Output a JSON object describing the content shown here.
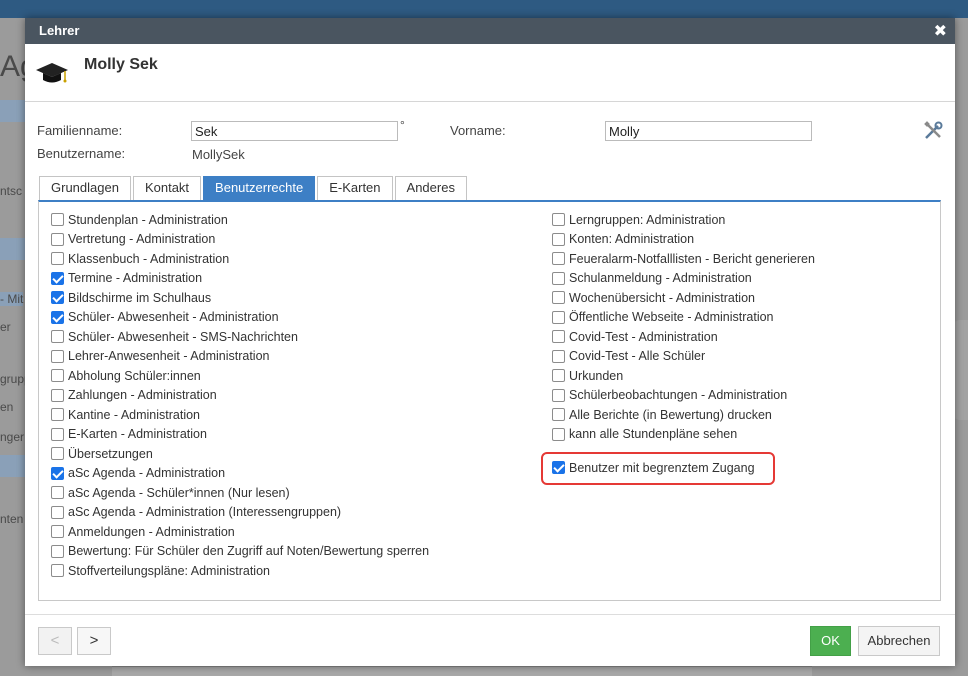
{
  "background": {
    "app_title_fragment": "Ag",
    "left_fragments": [
      "ntsc",
      "- Mit",
      "er",
      "grupp",
      "en",
      "nger",
      "nten"
    ]
  },
  "dialog": {
    "title": "Lehrer",
    "close_glyph": "✖",
    "teacher_name": "Molly Sek"
  },
  "form": {
    "familienname_label": "Familienname:",
    "familienname_value": "Sek",
    "degree_mark": "°",
    "vorname_label": "Vorname:",
    "vorname_value": "Molly",
    "benutzername_label": "Benutzername:",
    "benutzername_value": "MollySek"
  },
  "tabs": [
    {
      "label": "Grundlagen",
      "active": false
    },
    {
      "label": "Kontakt",
      "active": false
    },
    {
      "label": "Benutzerrechte",
      "active": true
    },
    {
      "label": "E-Karten",
      "active": false
    },
    {
      "label": "Anderes",
      "active": false
    }
  ],
  "permissions_left": [
    {
      "label": "Stundenplan - Administration",
      "checked": false
    },
    {
      "label": "Vertretung - Administration",
      "checked": false
    },
    {
      "label": "Klassenbuch - Administration",
      "checked": false
    },
    {
      "label": "Termine - Administration",
      "checked": true
    },
    {
      "label": "Bildschirme im Schulhaus",
      "checked": true
    },
    {
      "label": "Schüler- Abwesenheit - Administration",
      "checked": true
    },
    {
      "label": "Schüler- Abwesenheit - SMS-Nachrichten",
      "checked": false
    },
    {
      "label": "Lehrer-Anwesenheit - Administration",
      "checked": false
    },
    {
      "label": "Abholung Schüler:innen",
      "checked": false
    },
    {
      "label": "Zahlungen - Administration",
      "checked": false
    },
    {
      "label": "Kantine - Administration",
      "checked": false
    },
    {
      "label": "E-Karten - Administration",
      "checked": false
    },
    {
      "label": "Übersetzungen",
      "checked": false
    },
    {
      "label": "aSc Agenda - Administration",
      "checked": true
    },
    {
      "label": "aSc Agenda - Schüler*innen (Nur lesen)",
      "checked": false
    },
    {
      "label": "aSc Agenda - Administration (Interessengruppen)",
      "checked": false
    },
    {
      "label": "Anmeldungen - Administration",
      "checked": false
    },
    {
      "label": "Bewertung: Für Schüler den Zugriff auf Noten/Bewertung sperren",
      "checked": false
    },
    {
      "label": "Stoffverteilungspläne: Administration",
      "checked": false
    }
  ],
  "permissions_right": [
    {
      "label": "Lerngruppen: Administration",
      "checked": false
    },
    {
      "label": "Konten: Administration",
      "checked": false
    },
    {
      "label": "Feueralarm-Notfalllisten - Bericht generieren",
      "checked": false
    },
    {
      "label": "Schulanmeldung - Administration",
      "checked": false
    },
    {
      "label": "Wochenübersicht - Administration",
      "checked": false
    },
    {
      "label": "Öffentliche Webseite - Administration",
      "checked": false
    },
    {
      "label": "Covid-Test - Administration",
      "checked": false
    },
    {
      "label": "Covid-Test - Alle Schüler",
      "checked": false
    },
    {
      "label": "Urkunden",
      "checked": false
    },
    {
      "label": "Schülerbeobachtungen - Administration",
      "checked": false
    },
    {
      "label": "Alle Berichte (in Bewertung) drucken",
      "checked": false
    },
    {
      "label": "kann alle Stundenpläne sehen",
      "checked": false
    }
  ],
  "limited_access": {
    "label": "Benutzer mit begrenztem Zugang",
    "checked": true
  },
  "footer": {
    "prev_label": "<",
    "next_label": ">",
    "ok_label": "OK",
    "cancel_label": "Abbrechen"
  },
  "colors": {
    "titlebar": "#4a5560",
    "tab_active": "#3d7fc5",
    "ok_button": "#4caf50",
    "highlight": "#e53935",
    "checkbox_checked": "#1a73e8"
  }
}
